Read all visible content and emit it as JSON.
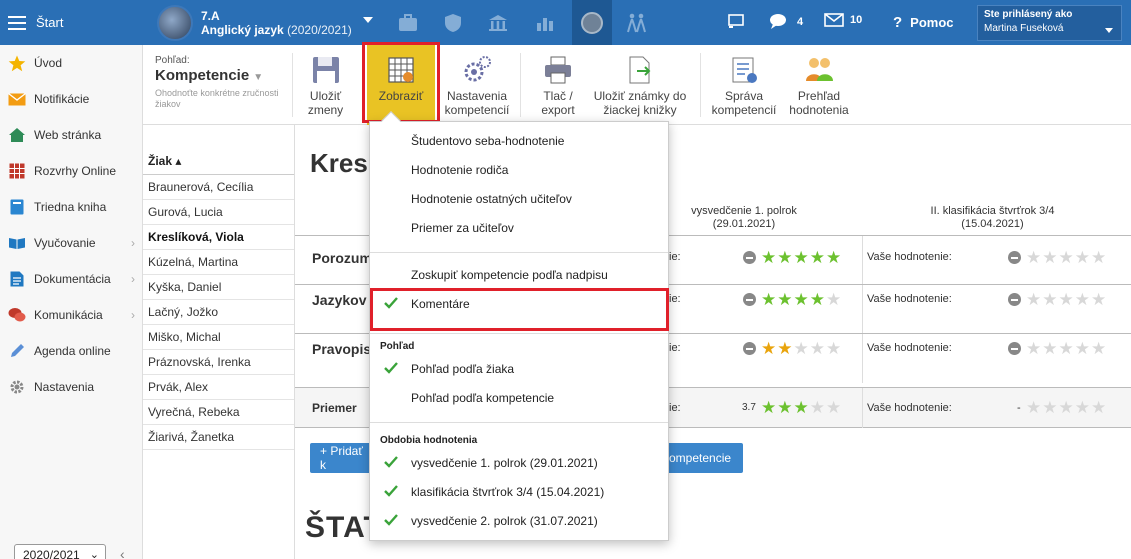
{
  "topbar": {
    "start_label": "Štart",
    "class_code": "7.A",
    "subject": "Anglický jazyk",
    "school_year": "(2020/2021)",
    "messages_count": "4",
    "mail_count": "10",
    "help_label": "Pomoc",
    "user_label": "Ste prihlásený ako",
    "user_name": "Martina Fuseková"
  },
  "sidebar": {
    "items": [
      {
        "label": "Úvod",
        "icon": "star-icon"
      },
      {
        "label": "Notifikácie",
        "icon": "envelope-icon"
      },
      {
        "label": "Web stránka",
        "icon": "home-icon"
      },
      {
        "label": "Rozvrhy Online",
        "icon": "calendar-icon"
      },
      {
        "label": "Triedna kniha",
        "icon": "book-icon"
      },
      {
        "label": "Vyučovanie",
        "icon": "open-book-icon"
      },
      {
        "label": "Dokumentácia",
        "icon": "document-icon"
      },
      {
        "label": "Komunikácia",
        "icon": "chat-icon"
      },
      {
        "label": "Agenda online",
        "icon": "pencil-icon"
      },
      {
        "label": "Nastavenia",
        "icon": "gear-icon"
      }
    ],
    "year_select": "2020/2021"
  },
  "toolbar": {
    "view_label": "Pohľad:",
    "view_value": "Kompetencie",
    "view_hint": "Ohodnoťte konkrétne zručnosti žiakov",
    "save_l1": "Uložiť",
    "save_l2": "zmeny",
    "show": "Zobraziť",
    "settings_l1": "Nastavenia",
    "settings_l2": "kompetencií",
    "print_l1": "Tlač /",
    "print_l2": "export",
    "store_l1": "Uložiť známky do",
    "store_l2": "žiackej knižky",
    "manage_l1": "Správa",
    "manage_l2": "kompetencií",
    "overview_l1": "Prehľad",
    "overview_l2": "hodnotenia"
  },
  "students": {
    "header": "Žiak ▴",
    "list": [
      "Braunerová, Cecília",
      "Gurová, Lucia",
      "Kreslíková, Viola",
      "Kúzelná, Martina",
      "Kyška, Daniel",
      "Lačný, Jožko",
      "Miško, Michal",
      "Práznovská, Irenka",
      "Prvák, Alex",
      "Vyrečná, Rebeka",
      "Žiarivá, Žanetka"
    ],
    "selected_index": 2
  },
  "main": {
    "title": "Kresl",
    "col1_l1": "vysvedčenie 1. polrok",
    "col1_l2": "(29.01.2021)",
    "col2_l1": "II. klasifikácia štvrťrok 3/4",
    "col2_l2": "(15.04.2021)",
    "rows": [
      {
        "name": "Porozum",
        "cell1": "ie:",
        "cell2": "Vaše hodnotenie:",
        "rating": 5,
        "color": "green"
      },
      {
        "name": "Jazykov",
        "cell1": "ie:",
        "cell2": "Vaše hodnotenie:",
        "rating": 4,
        "color": "green"
      },
      {
        "name": "Pravopis",
        "cell1": "ie:",
        "cell2": "Vaše hodnotenie:",
        "rating": 2,
        "color": "orange"
      }
    ],
    "average_label": "Priemer",
    "average_cell1": "ie:",
    "average_value": "3.7",
    "average_rating": 3,
    "average_cell2": "Vaše hodnotenie:",
    "average_dash": "-",
    "add_button": "+ Pridať k",
    "competence_button": "ompetencie",
    "stat_title": "ŠTAT"
  },
  "dropdown": {
    "items": [
      {
        "label": "Študentovo seba-hodnotenie",
        "checked": false
      },
      {
        "label": "Hodnotenie rodiča",
        "checked": false
      },
      {
        "label": "Hodnotenie ostatných učiteľov",
        "checked": false
      },
      {
        "label": "Priemer za učiteľov",
        "checked": false
      }
    ],
    "group_label": "Zoskupiť kompetencie podľa nadpisu",
    "comments_label": "Komentáre",
    "view_section": "Pohľad",
    "view_items": [
      {
        "label": "Pohľad podľa žiaka",
        "checked": true
      },
      {
        "label": "Pohľad podľa kompetencie",
        "checked": false
      }
    ],
    "periods_section": "Obdobia hodnotenia",
    "periods": [
      {
        "label": "vysvedčenie 1. polrok (29.01.2021)",
        "checked": true
      },
      {
        "label": "klasifikácia štvrťrok 3/4 (15.04.2021)",
        "checked": true
      },
      {
        "label": "vysvedčenie 2. polrok (31.07.2021)",
        "checked": true
      }
    ]
  },
  "colors": {
    "brand": "#2a6fb5",
    "highlight": "#e0202a",
    "active_button": "#e9c324",
    "star_green": "#6cc12f",
    "star_orange": "#e9a40d",
    "check_green": "#3aa33a"
  }
}
